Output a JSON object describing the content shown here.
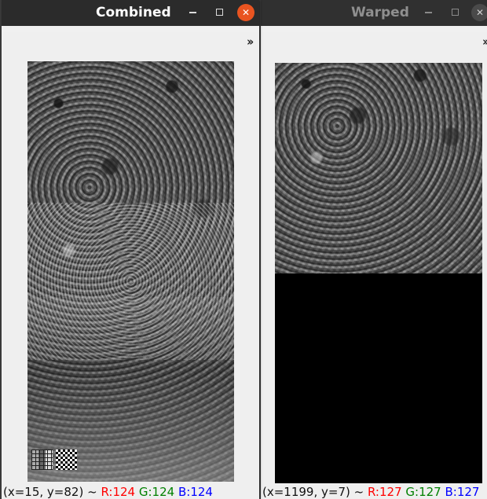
{
  "windows": {
    "combined": {
      "title": "Combined",
      "expand_label": "››",
      "status": {
        "coords": "(x=15, y=82) ~",
        "r": "R:124",
        "g": "G:124",
        "b": "B:124"
      }
    },
    "warped": {
      "title": "Warped",
      "expand_label": "››",
      "status": {
        "coords": "(x=1199, y=7) ~",
        "r": "R:127",
        "g": "G:127",
        "b": "B:127"
      }
    }
  },
  "colors": {
    "title_bar": "#2b2b2b",
    "close_active": "#e95420",
    "red": "#ff0000",
    "green": "#008000",
    "blue": "#0000ff"
  },
  "icons": {
    "minimize": "minimize-icon",
    "maximize": "maximize-icon",
    "close": "close-icon"
  }
}
